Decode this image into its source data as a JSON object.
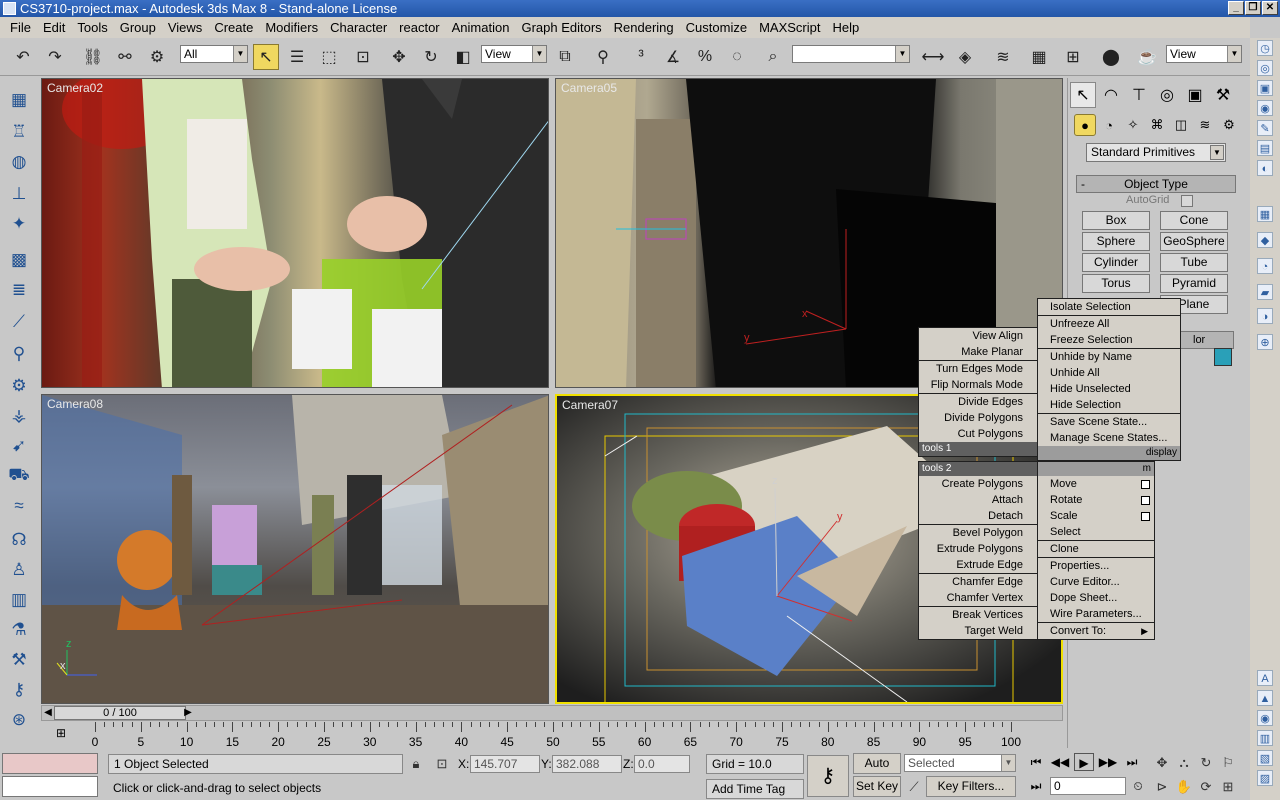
{
  "window": {
    "title": "CS3710-project.max - Autodesk 3ds Max 8  - Stand-alone License"
  },
  "menu": [
    "File",
    "Edit",
    "Tools",
    "Group",
    "Views",
    "Create",
    "Modifiers",
    "Character",
    "reactor",
    "Animation",
    "Graph Editors",
    "Rendering",
    "Customize",
    "MAXScript",
    "Help"
  ],
  "toolbar": {
    "selection_filter": "All",
    "ref_coord": "View",
    "named_sel": "",
    "view_right": "View"
  },
  "viewports": [
    "Camera02",
    "Camera05",
    "Camera08",
    "Camera07"
  ],
  "command_panel": {
    "category": "Standard Primitives",
    "rollout_title": "Object Type",
    "autogrid": "AutoGrid",
    "primitives": [
      "Box",
      "Cone",
      "Sphere",
      "GeoSphere",
      "Cylinder",
      "Tube",
      "Torus",
      "Pyramid",
      "",
      "Plane"
    ],
    "color_label": "lor",
    "color_hex": "#2aa0b8"
  },
  "quad_menu": {
    "top_left": [
      "View Align",
      "Make Planar",
      "Turn Edges Mode",
      "Flip Normals Mode",
      "Divide Edges",
      "Divide Polygons",
      "Cut Polygons"
    ],
    "top_right": [
      "Isolate Selection",
      "Unfreeze All",
      "Freeze Selection",
      "Unhide by Name",
      "Unhide All",
      "Hide Unselected",
      "Hide Selection",
      "Save Scene State...",
      "Manage Scene States..."
    ],
    "title_tools1": "tools 1",
    "title_display": "display",
    "title_tools2": "tools 2",
    "title_transform": "m",
    "bottom_left": [
      "Create Polygons",
      "Attach",
      "Detach",
      "Bevel Polygon",
      "Extrude Polygons",
      "Extrude Edge",
      "Chamfer Edge",
      "Chamfer Vertex",
      "Break Vertices",
      "Target Weld"
    ],
    "bottom_right": [
      "Move",
      "Rotate",
      "Scale",
      "Select",
      "Clone",
      "Properties...",
      "Curve Editor...",
      "Dope Sheet...",
      "Wire Parameters...",
      "Convert To:"
    ]
  },
  "timeline": {
    "frame_display": "0 / 100",
    "ticks": [
      "0",
      "5",
      "10",
      "15",
      "20",
      "25",
      "30",
      "35",
      "40",
      "45",
      "50",
      "55",
      "60",
      "65",
      "70",
      "75",
      "80",
      "85",
      "90",
      "95",
      "100"
    ]
  },
  "status": {
    "selection": "1 Object Selected",
    "prompt": "Click or click-and-drag to select objects",
    "x_label": "X:",
    "x": "145.707",
    "y_label": "Y:",
    "y": "382.088",
    "z_label": "Z:",
    "z": "0.0",
    "grid": "Grid = 10.0",
    "add_time_tag": "Add Time Tag",
    "auto_key": "Auto Key",
    "set_key": "Set Key",
    "key_mode": "Selected",
    "key_filters": "Key Filters...",
    "current_frame": "0"
  }
}
